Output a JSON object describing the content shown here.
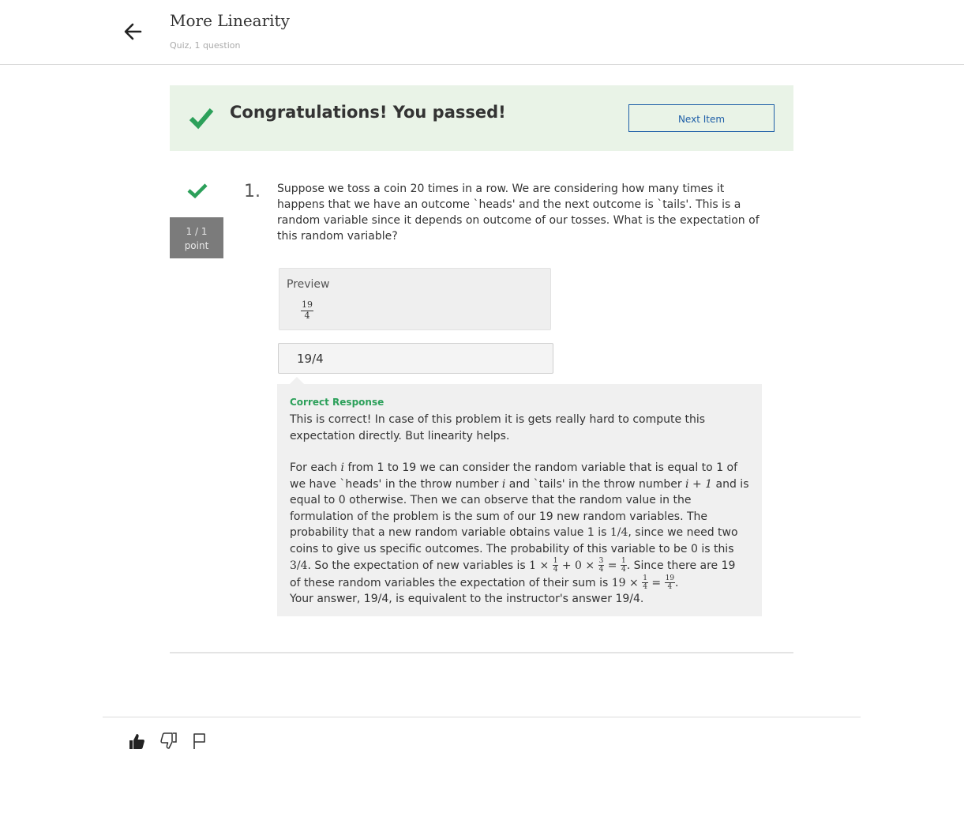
{
  "header": {
    "title": "More Linearity",
    "subtitle": "Quiz, 1 question"
  },
  "banner": {
    "message": "Congratulations! You passed!",
    "next_button": "Next Item"
  },
  "question": {
    "number": "1.",
    "score_value": "1 / 1",
    "score_unit": "point",
    "text": "Suppose we toss a coin 20 times in a row. We are considering how many times it happens that we have an outcome `heads' and the next outcome is `tails'. This is a random variable since it depends on outcome of our tosses. What is the expectation of this random variable?"
  },
  "preview": {
    "label": "Preview",
    "numerator": "19",
    "denominator": "4"
  },
  "answer": {
    "value": "19/4"
  },
  "feedback": {
    "heading": "Correct Response",
    "paragraph1": "This is correct! In case of this problem it is gets really hard to compute this expectation directly. But linearity helps.",
    "p2": {
      "t1": "For each ",
      "i": "i",
      "t2": " from 1 to 19 we can consider the random variable that is equal to 1 of we have `heads' in the throw number ",
      "t3": " and `tails' in the throw number ",
      "i_plus_1": "i + 1",
      "t4": " and is equal to 0 otherwise. Then we can observe that the random value in the formulation of the problem is the sum of our 19 new random variables. The probability that a new random variable obtains value 1 is ",
      "one_quarter": "1/4",
      "t5": ", since we need two coins to give us specific outcomes. The probability of this variable to be 0 is this ",
      "three_quarters": "3/4",
      "t6": ". So the expectation of new variables is ",
      "m_one": "1 × ",
      "m_plus_zero": " + 0 × ",
      "m_equals": " = ",
      "t7": ". Since there are 19 of these random variables the expectation of their sum is ",
      "m_nineteen": "19 × ",
      "t8": "."
    },
    "frac_1": "1",
    "frac_3": "3",
    "frac_4": "4",
    "frac_19": "19",
    "summary": "Your answer, 19/4, is equivalent to the instructor's answer 19/4."
  },
  "colors": {
    "success_green": "#2ca05a",
    "banner_bg": "#e9f3e7",
    "link_blue": "#1f5fa8",
    "score_gray": "#7b7b7b"
  },
  "icons": [
    "arrow-left-icon",
    "checkmark-icon",
    "thumbs-up-icon",
    "thumbs-down-icon",
    "flag-icon"
  ]
}
